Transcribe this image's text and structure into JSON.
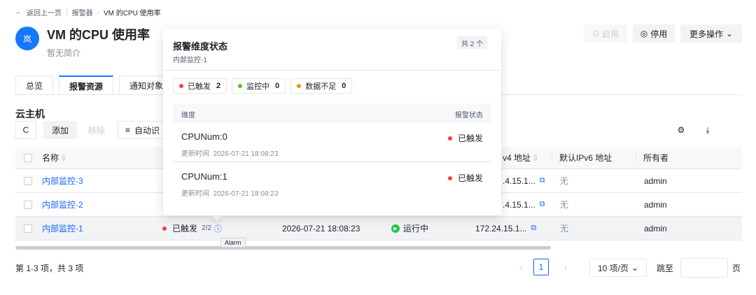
{
  "breadcrumb": {
    "back": "返回上一页",
    "parent": "报警器",
    "current": "VM 的CPU 使用率"
  },
  "header": {
    "icon_text": "岚",
    "title": "VM 的CPU 使用率",
    "subtitle": "暂无简介",
    "enable_label": "启用",
    "disable_label": "停用",
    "more_label": "更多操作"
  },
  "tabs": [
    "总览",
    "报警资源",
    "通知对象"
  ],
  "section": {
    "title": "云主机",
    "add_label": "添加",
    "remove_label": "移除",
    "auto_label": "自动识"
  },
  "table": {
    "headers": {
      "name": "名称",
      "ipv4": "v4 地址",
      "ipv6": "默认IPv6 地址",
      "owner": "所有者"
    },
    "rows": [
      {
        "name": "内部监控-3",
        "ipv4": ".4.15.1...",
        "ipv6": "无",
        "owner": "admin"
      },
      {
        "name": "内部监控-2",
        "ipv4": ".4.15.1...",
        "ipv6": "无",
        "owner": "admin"
      },
      {
        "name": "内部监控-1",
        "alarm": "已触发",
        "alarm_count": "2/2",
        "time": "2026-07-21 18:08:23",
        "run_state": "运行中",
        "ipv4": "172.24.15.1...",
        "ipv6": "无",
        "owner": "admin"
      }
    ]
  },
  "tooltip": "Alarm",
  "pagination": {
    "summary": "第 1-3 项，共 3 项",
    "current_page": "1",
    "page_size": "10 项/页",
    "goto_label": "跳至",
    "page_suffix": "页"
  },
  "popover": {
    "title": "报警维度状态",
    "subtitle": "内部监控-1",
    "total": "共 2 个",
    "tags": [
      {
        "label": "已触发",
        "count": "2",
        "color": "#f53f3f"
      },
      {
        "label": "监控中",
        "count": "0",
        "color": "#52c41a"
      },
      {
        "label": "数据不足",
        "count": "0",
        "color": "#fa8c16"
      }
    ],
    "col_dimension": "维度",
    "col_state": "报警状态",
    "items": [
      {
        "name": "CPUNum:0",
        "updated_label": "更新时间",
        "updated": "2026-07-21 18:08:23",
        "state": "已触发"
      },
      {
        "name": "CPUNum:1",
        "updated_label": "更新时间",
        "updated": "2026-07-21 18:08:23",
        "state": "已触发"
      }
    ]
  },
  "colors": {
    "accent": "#1664ff",
    "danger": "#f53f3f",
    "success": "#23c343"
  }
}
